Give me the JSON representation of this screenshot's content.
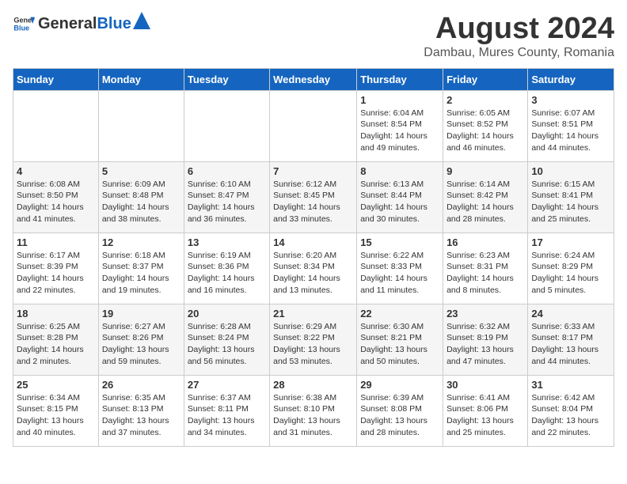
{
  "header": {
    "logo_general": "General",
    "logo_blue": "Blue",
    "main_title": "August 2024",
    "subtitle": "Dambau, Mures County, Romania"
  },
  "calendar": {
    "days_of_week": [
      "Sunday",
      "Monday",
      "Tuesday",
      "Wednesday",
      "Thursday",
      "Friday",
      "Saturday"
    ],
    "weeks": [
      [
        {
          "day": "",
          "info": ""
        },
        {
          "day": "",
          "info": ""
        },
        {
          "day": "",
          "info": ""
        },
        {
          "day": "",
          "info": ""
        },
        {
          "day": "1",
          "info": "Sunrise: 6:04 AM\nSunset: 8:54 PM\nDaylight: 14 hours\nand 49 minutes."
        },
        {
          "day": "2",
          "info": "Sunrise: 6:05 AM\nSunset: 8:52 PM\nDaylight: 14 hours\nand 46 minutes."
        },
        {
          "day": "3",
          "info": "Sunrise: 6:07 AM\nSunset: 8:51 PM\nDaylight: 14 hours\nand 44 minutes."
        }
      ],
      [
        {
          "day": "4",
          "info": "Sunrise: 6:08 AM\nSunset: 8:50 PM\nDaylight: 14 hours\nand 41 minutes."
        },
        {
          "day": "5",
          "info": "Sunrise: 6:09 AM\nSunset: 8:48 PM\nDaylight: 14 hours\nand 38 minutes."
        },
        {
          "day": "6",
          "info": "Sunrise: 6:10 AM\nSunset: 8:47 PM\nDaylight: 14 hours\nand 36 minutes."
        },
        {
          "day": "7",
          "info": "Sunrise: 6:12 AM\nSunset: 8:45 PM\nDaylight: 14 hours\nand 33 minutes."
        },
        {
          "day": "8",
          "info": "Sunrise: 6:13 AM\nSunset: 8:44 PM\nDaylight: 14 hours\nand 30 minutes."
        },
        {
          "day": "9",
          "info": "Sunrise: 6:14 AM\nSunset: 8:42 PM\nDaylight: 14 hours\nand 28 minutes."
        },
        {
          "day": "10",
          "info": "Sunrise: 6:15 AM\nSunset: 8:41 PM\nDaylight: 14 hours\nand 25 minutes."
        }
      ],
      [
        {
          "day": "11",
          "info": "Sunrise: 6:17 AM\nSunset: 8:39 PM\nDaylight: 14 hours\nand 22 minutes."
        },
        {
          "day": "12",
          "info": "Sunrise: 6:18 AM\nSunset: 8:37 PM\nDaylight: 14 hours\nand 19 minutes."
        },
        {
          "day": "13",
          "info": "Sunrise: 6:19 AM\nSunset: 8:36 PM\nDaylight: 14 hours\nand 16 minutes."
        },
        {
          "day": "14",
          "info": "Sunrise: 6:20 AM\nSunset: 8:34 PM\nDaylight: 14 hours\nand 13 minutes."
        },
        {
          "day": "15",
          "info": "Sunrise: 6:22 AM\nSunset: 8:33 PM\nDaylight: 14 hours\nand 11 minutes."
        },
        {
          "day": "16",
          "info": "Sunrise: 6:23 AM\nSunset: 8:31 PM\nDaylight: 14 hours\nand 8 minutes."
        },
        {
          "day": "17",
          "info": "Sunrise: 6:24 AM\nSunset: 8:29 PM\nDaylight: 14 hours\nand 5 minutes."
        }
      ],
      [
        {
          "day": "18",
          "info": "Sunrise: 6:25 AM\nSunset: 8:28 PM\nDaylight: 14 hours\nand 2 minutes."
        },
        {
          "day": "19",
          "info": "Sunrise: 6:27 AM\nSunset: 8:26 PM\nDaylight: 13 hours\nand 59 minutes."
        },
        {
          "day": "20",
          "info": "Sunrise: 6:28 AM\nSunset: 8:24 PM\nDaylight: 13 hours\nand 56 minutes."
        },
        {
          "day": "21",
          "info": "Sunrise: 6:29 AM\nSunset: 8:22 PM\nDaylight: 13 hours\nand 53 minutes."
        },
        {
          "day": "22",
          "info": "Sunrise: 6:30 AM\nSunset: 8:21 PM\nDaylight: 13 hours\nand 50 minutes."
        },
        {
          "day": "23",
          "info": "Sunrise: 6:32 AM\nSunset: 8:19 PM\nDaylight: 13 hours\nand 47 minutes."
        },
        {
          "day": "24",
          "info": "Sunrise: 6:33 AM\nSunset: 8:17 PM\nDaylight: 13 hours\nand 44 minutes."
        }
      ],
      [
        {
          "day": "25",
          "info": "Sunrise: 6:34 AM\nSunset: 8:15 PM\nDaylight: 13 hours\nand 40 minutes."
        },
        {
          "day": "26",
          "info": "Sunrise: 6:35 AM\nSunset: 8:13 PM\nDaylight: 13 hours\nand 37 minutes."
        },
        {
          "day": "27",
          "info": "Sunrise: 6:37 AM\nSunset: 8:11 PM\nDaylight: 13 hours\nand 34 minutes."
        },
        {
          "day": "28",
          "info": "Sunrise: 6:38 AM\nSunset: 8:10 PM\nDaylight: 13 hours\nand 31 minutes."
        },
        {
          "day": "29",
          "info": "Sunrise: 6:39 AM\nSunset: 8:08 PM\nDaylight: 13 hours\nand 28 minutes."
        },
        {
          "day": "30",
          "info": "Sunrise: 6:41 AM\nSunset: 8:06 PM\nDaylight: 13 hours\nand 25 minutes."
        },
        {
          "day": "31",
          "info": "Sunrise: 6:42 AM\nSunset: 8:04 PM\nDaylight: 13 hours\nand 22 minutes."
        }
      ]
    ]
  }
}
